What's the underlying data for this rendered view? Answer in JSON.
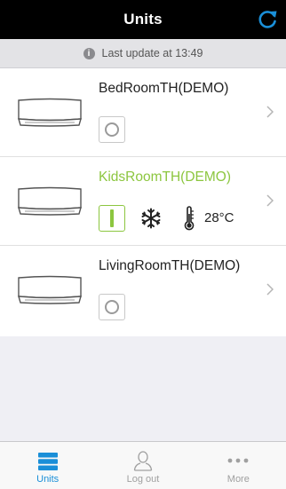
{
  "header": {
    "title": "Units",
    "accent": "#1a8fd8"
  },
  "status": {
    "text": "Last update at 13:49",
    "icon": "info-icon"
  },
  "units": [
    {
      "name": "BedRoomTH(DEMO)",
      "power": "off"
    },
    {
      "name": "KidsRoomTH(DEMO)",
      "power": "on",
      "mode_icon": "snowflake-icon",
      "temperature": "28°C"
    },
    {
      "name": "LivingRoomTH(DEMO)",
      "power": "off"
    }
  ],
  "tabs": [
    {
      "label": "Units",
      "icon": "units-icon",
      "selected": true
    },
    {
      "label": "Log out",
      "icon": "user-icon",
      "selected": false
    },
    {
      "label": "More",
      "icon": "more-icon",
      "selected": false
    }
  ],
  "colors": {
    "active_green": "#8cc63f",
    "tab_blue": "#1a8fd8"
  }
}
